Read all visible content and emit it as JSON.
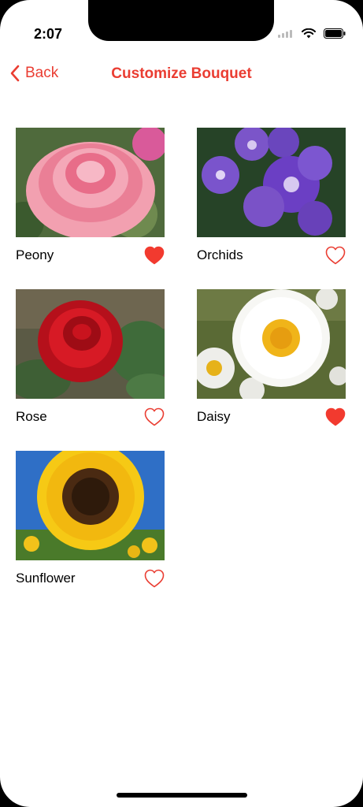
{
  "status": {
    "time": "2:07"
  },
  "nav": {
    "back_label": "Back",
    "title": "Customize Bouquet"
  },
  "colors": {
    "accent": "#ea3d32",
    "heart_filled": "#f23a2f"
  },
  "flowers": [
    {
      "name": "Peony",
      "favorite": true
    },
    {
      "name": "Orchids",
      "favorite": false
    },
    {
      "name": "Rose",
      "favorite": false
    },
    {
      "name": "Daisy",
      "favorite": true
    },
    {
      "name": "Sunflower",
      "favorite": false
    }
  ]
}
